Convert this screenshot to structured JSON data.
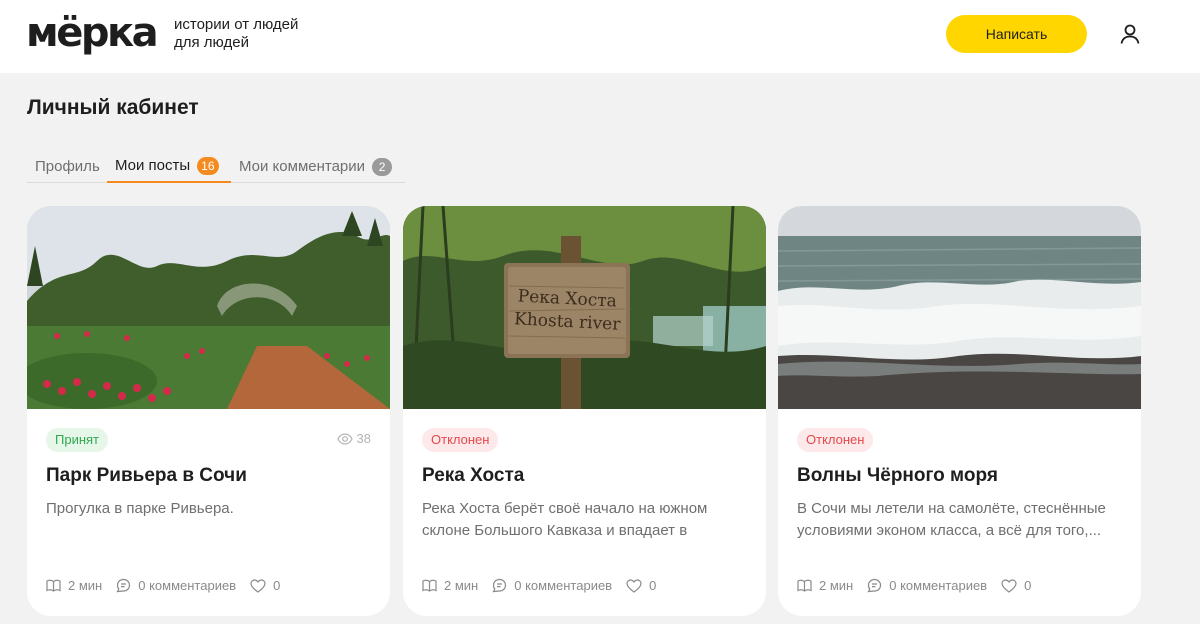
{
  "header": {
    "logo": "мёрка",
    "tagline_line1": "истории от людей",
    "tagline_line2": "для людей",
    "write_button": "Написать",
    "user_icon": "user-icon"
  },
  "page_title": "Личный кабинет",
  "tabs": [
    {
      "label": "Профиль"
    },
    {
      "label": "Мои посты",
      "count": "16"
    },
    {
      "label": "Мои комментарии",
      "count": "2"
    }
  ],
  "colors": {
    "accent_yellow": "#ffd600",
    "accent_orange": "#f58a1f",
    "status_accepted": "#2fa84f",
    "status_rejected": "#e5484d"
  },
  "posts": [
    {
      "status": "Принят",
      "views": "38",
      "title": "Парк Ривьера в Сочи",
      "description": "Прогулка в парке Ривьера.",
      "read_time": "2 мин",
      "comments": "0 комментариев",
      "likes": "0"
    },
    {
      "status": "Отклонен",
      "title": "Река Хоста",
      "description": "Река Хоста берёт своё начало на южном склоне Большого Кавказа и впадает в Чёрно...",
      "image_sign_line1": "Река Хоста",
      "image_sign_line2": "Khosta river",
      "read_time": "2 мин",
      "comments": "0 комментариев",
      "likes": "0"
    },
    {
      "status": "Отклонен",
      "title": "Волны Чёрного моря",
      "description": "В Сочи мы летели на самолёте, стеснённые условиями эконом класса, а всё для того,...",
      "read_time": "2 мин",
      "comments": "0 комментариев",
      "likes": "0"
    }
  ]
}
